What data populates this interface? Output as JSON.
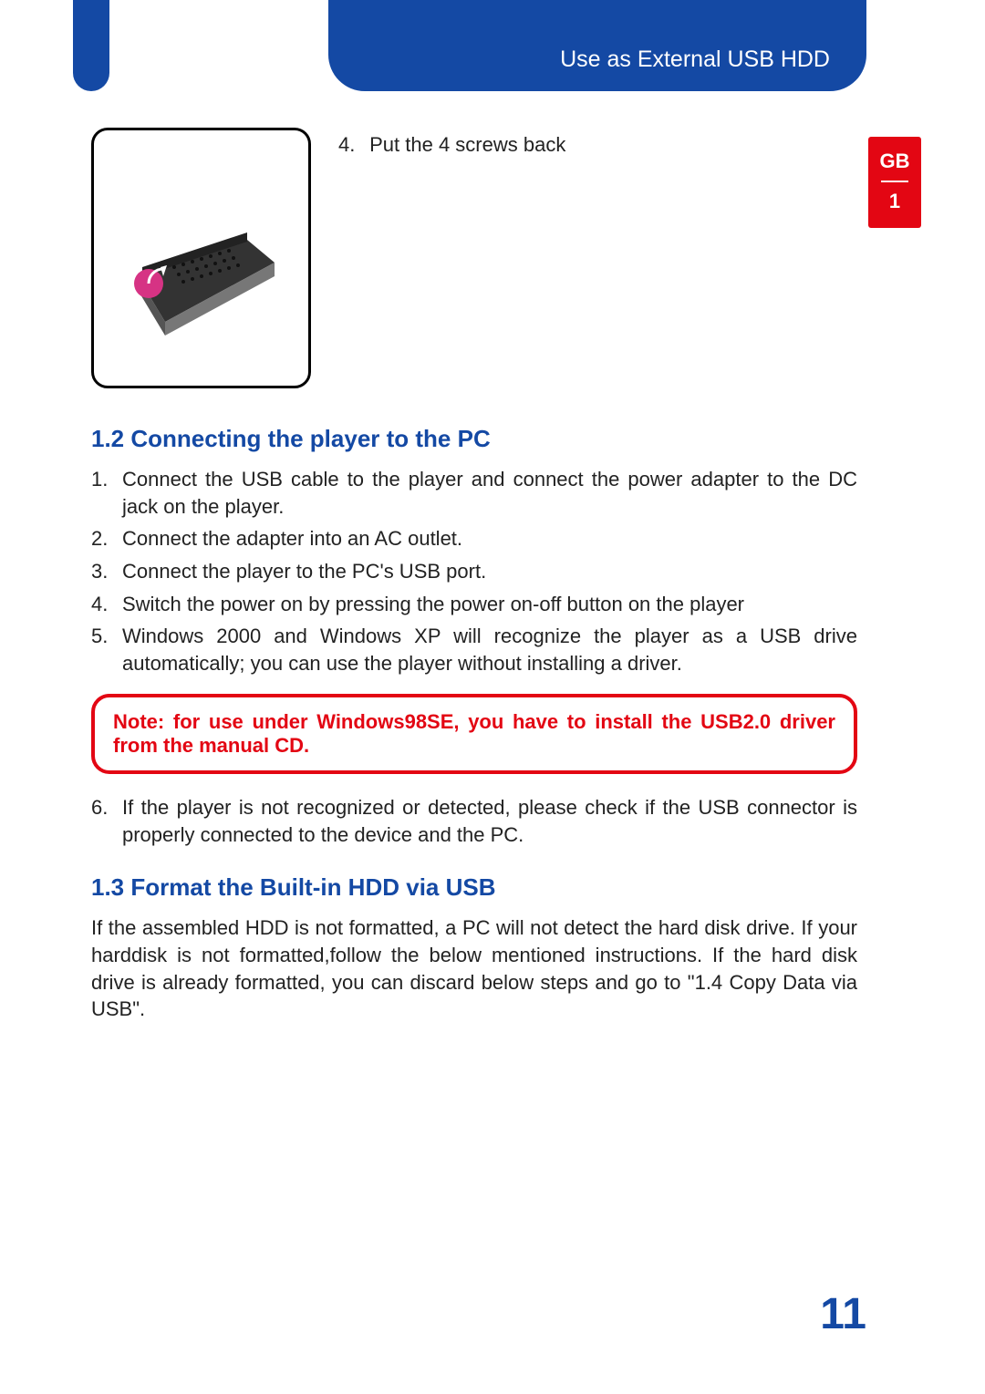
{
  "header": {
    "title": "Use as External USB HDD"
  },
  "side_badge": {
    "lang": "GB",
    "chapter": "1"
  },
  "top_step": {
    "number": "4.",
    "text": "Put the 4 screws back"
  },
  "section_1_2": {
    "title": "1.2 Connecting the player to the PC",
    "steps_a": [
      {
        "n": "1.",
        "t": "Connect the USB cable to the player and connect the power adapter to the DC jack on the player."
      },
      {
        "n": "2.",
        "t": "Connect the adapter into an AC outlet."
      },
      {
        "n": "3.",
        "t": "Connect the player to the PC's USB port."
      },
      {
        "n": "4.",
        "t": "Switch the power on by pressing the power on-off button on the player"
      },
      {
        "n": "5.",
        "t": "Windows 2000 and Windows XP will recognize the player as a USB drive automatically; you can use the player without installing a driver."
      }
    ],
    "note": "Note:  for use under Windows98SE,  you have to install the USB2.0 driver from the manual CD.",
    "steps_b": [
      {
        "n": "6.",
        "t": "If the player is not recognized or detected, please check if the USB connector is properly connected to the device and the PC."
      }
    ]
  },
  "section_1_3": {
    "title": "1.3 Format the Built-in HDD via USB",
    "body": "If the assembled HDD is not formatted, a PC will not detect the hard disk drive. If your harddisk is not formatted,follow the below mentioned instructions. If the hard disk drive is already formatted, you can discard below steps and go to \"1.4 Copy Data via USB\"."
  },
  "page_number": "11"
}
